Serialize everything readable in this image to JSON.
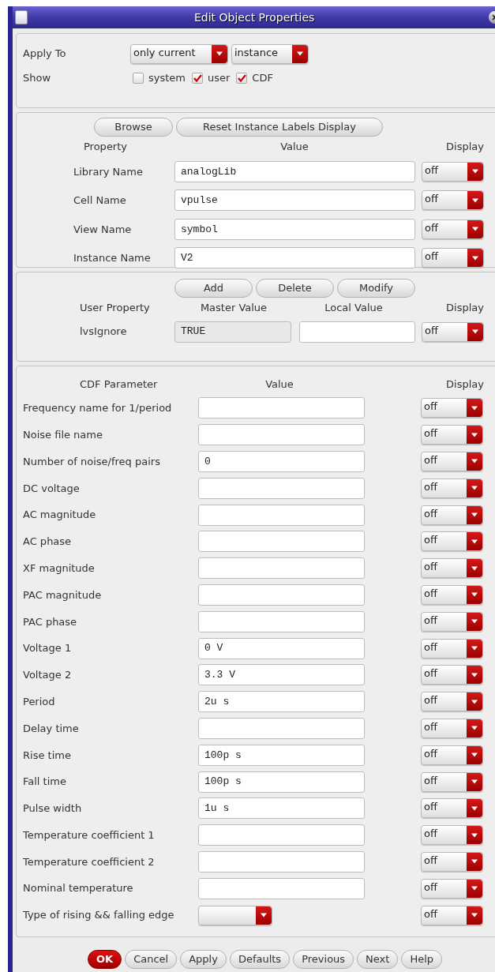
{
  "window": {
    "title": "Edit Object Properties"
  },
  "apply_to": {
    "label": "Apply To",
    "dropdowns": [
      {
        "value": "only current"
      },
      {
        "value": "instance"
      }
    ]
  },
  "show": {
    "label": "Show",
    "options": [
      {
        "label": "system",
        "checked": false
      },
      {
        "label": "user",
        "checked": true
      },
      {
        "label": "CDF",
        "checked": true
      }
    ]
  },
  "property_section": {
    "buttons": [
      "Browse",
      "Reset Instance Labels Display"
    ],
    "headers": [
      "Property",
      "Value",
      "Display"
    ],
    "rows": [
      {
        "label": "Library Name",
        "value": "analogLib",
        "display": "off"
      },
      {
        "label": "Cell Name",
        "value": "vpulse",
        "display": "off"
      },
      {
        "label": "View Name",
        "value": "symbol",
        "display": "off"
      },
      {
        "label": "Instance Name",
        "value": "V2",
        "display": "off"
      }
    ]
  },
  "user_property_section": {
    "buttons": [
      "Add",
      "Delete",
      "Modify"
    ],
    "headers": [
      "User Property",
      "Master Value",
      "Local Value",
      "Display"
    ],
    "rows": [
      {
        "label": "lvsIgnore",
        "master_value": "TRUE",
        "local_value": "",
        "display": "off"
      }
    ]
  },
  "cdf_section": {
    "headers": [
      "CDF Parameter",
      "Value",
      "Display"
    ],
    "rows": [
      {
        "label": "Frequency name for 1/period",
        "kind": "field",
        "value": "",
        "display": "off"
      },
      {
        "label": "Noise file name",
        "kind": "field",
        "value": "",
        "display": "off"
      },
      {
        "label": "Number of noise/freq pairs",
        "kind": "field",
        "value": "0",
        "display": "off"
      },
      {
        "label": "DC voltage",
        "kind": "field",
        "value": "",
        "display": "off"
      },
      {
        "label": "AC magnitude",
        "kind": "field",
        "value": "",
        "display": "off"
      },
      {
        "label": "AC phase",
        "kind": "field",
        "value": "",
        "display": "off"
      },
      {
        "label": "XF magnitude",
        "kind": "field",
        "value": "",
        "display": "off"
      },
      {
        "label": "PAC magnitude",
        "kind": "field",
        "value": "",
        "display": "off"
      },
      {
        "label": "PAC phase",
        "kind": "field",
        "value": "",
        "display": "off"
      },
      {
        "label": "Voltage 1",
        "kind": "field",
        "value": "0 V",
        "display": "off"
      },
      {
        "label": "Voltage 2",
        "kind": "field",
        "value": "3.3 V",
        "display": "off"
      },
      {
        "label": "Period",
        "kind": "field",
        "value": "2u s",
        "display": "off"
      },
      {
        "label": "Delay time",
        "kind": "field",
        "value": "",
        "display": "off"
      },
      {
        "label": "Rise time",
        "kind": "field",
        "value": "100p s",
        "display": "off"
      },
      {
        "label": "Fall time",
        "kind": "field",
        "value": "100p s",
        "display": "off"
      },
      {
        "label": "Pulse width",
        "kind": "field",
        "value": "1u s",
        "display": "off"
      },
      {
        "label": "Temperature coefficient 1",
        "kind": "field",
        "value": "",
        "display": "off"
      },
      {
        "label": "Temperature coefficient 2",
        "kind": "field",
        "value": "",
        "display": "off"
      },
      {
        "label": "Nominal temperature",
        "kind": "field",
        "value": "",
        "display": "off"
      },
      {
        "label": "Type of rising && falling edge",
        "kind": "cycle",
        "value": "",
        "display": "off"
      }
    ]
  },
  "footer_buttons": [
    {
      "label": "OK",
      "primary": true
    },
    {
      "label": "Cancel",
      "primary": false
    },
    {
      "label": "Apply",
      "primary": false
    },
    {
      "label": "Defaults",
      "primary": false
    },
    {
      "label": "Previous",
      "primary": false
    },
    {
      "label": "Next",
      "primary": false
    },
    {
      "label": "Help",
      "primary": false
    }
  ]
}
